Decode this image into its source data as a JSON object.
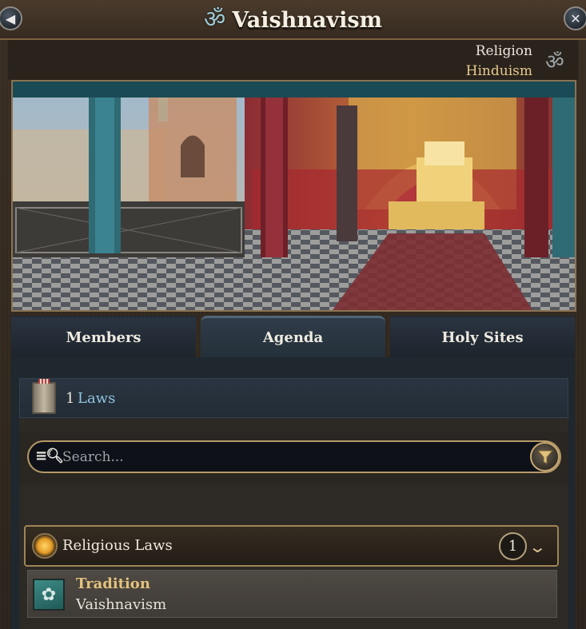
{
  "window": {
    "title": "Vaishnavism",
    "title_icon": "om-icon",
    "back_icon": "back-arrow-icon",
    "close_icon": "close-x-icon"
  },
  "religion": {
    "label": "Religion",
    "value": "Hinduism",
    "icon": "om-icon"
  },
  "tabs": [
    {
      "label": "Members",
      "active": false
    },
    {
      "label": "Agenda",
      "active": true
    },
    {
      "label": "Holy Sites",
      "active": false
    }
  ],
  "laws": {
    "count": "1",
    "label": "Laws"
  },
  "search": {
    "placeholder": "Search...",
    "value": ""
  },
  "category": {
    "label": "Religious Laws",
    "count": "1"
  },
  "law_items": [
    {
      "title": "Tradition",
      "subtitle": "Vaishnavism"
    }
  ],
  "colors": {
    "accent_gold": "#e2c27c",
    "laws_link": "#8fc3de",
    "tab_bg": "#2a3440"
  }
}
